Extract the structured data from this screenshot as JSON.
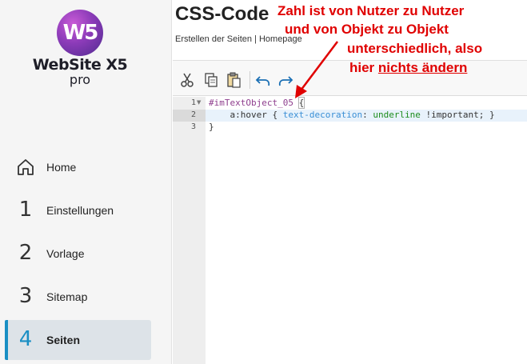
{
  "app": {
    "logo_mark": "W5",
    "logo_name": "WebSite X5",
    "logo_edition": "pro"
  },
  "sidebar": {
    "items": [
      {
        "num": "",
        "icon": "home-icon",
        "label": "Home",
        "active": false
      },
      {
        "num": "1",
        "label": "Einstellungen",
        "active": false
      },
      {
        "num": "2",
        "label": "Vorlage",
        "active": false
      },
      {
        "num": "3",
        "label": "Sitemap",
        "active": false
      },
      {
        "num": "4",
        "label": "Seiten",
        "active": true
      }
    ]
  },
  "header": {
    "title": "CSS-Code",
    "breadcrumb": "Erstellen der Seiten | Homepage"
  },
  "toolbar": {
    "buttons": [
      "cut-icon",
      "copy-icon",
      "paste-icon",
      "undo-icon",
      "redo-icon"
    ]
  },
  "editor": {
    "line_numbers": [
      "1",
      "2",
      "3"
    ],
    "line1": {
      "selector": "#imTextObject_05",
      "brace": "{"
    },
    "line2": {
      "indent": "    ",
      "element": "a:hover",
      "open": " { ",
      "property": "text-decoration",
      "colon": ": ",
      "value": "underline",
      "rest": " !important; }"
    },
    "line3": "}"
  },
  "annotation": {
    "line1": "Zahl ist von Nutzer zu Nutzer",
    "line2": "und von Objekt zu Objekt",
    "line3": "unterschiedlich, also",
    "line4_prefix": "hier ",
    "line4_emph": "nichts ändern",
    "color": "#e00000"
  }
}
